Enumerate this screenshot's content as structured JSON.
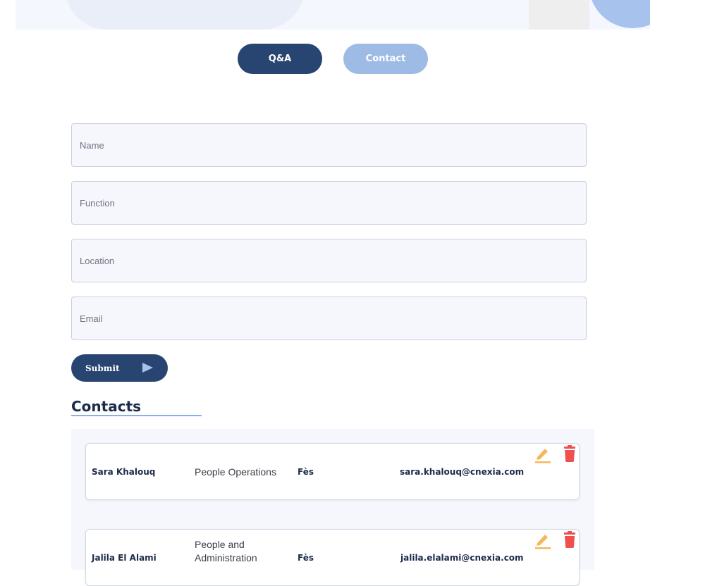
{
  "tabs": [
    {
      "label": "Q&A",
      "active": true
    },
    {
      "label": "Contact",
      "active": false
    }
  ],
  "form": {
    "fields": [
      {
        "placeholder": "Name",
        "value": ""
      },
      {
        "placeholder": "Function",
        "value": ""
      },
      {
        "placeholder": "Location",
        "value": ""
      },
      {
        "placeholder": "Email",
        "value": ""
      }
    ],
    "submit_label": "Submit"
  },
  "contacts": {
    "title": "Contacts",
    "rows": [
      {
        "name": "Sara Khalouq",
        "function": "People Operations",
        "location": "Fès",
        "email": "sara.khalouq@cnexia.com"
      },
      {
        "name": "Jalila El Alami",
        "function": "People and Administration",
        "location": "Fès",
        "email": "jalila.elalami@cnexia.com"
      }
    ]
  },
  "colors": {
    "primary": "#284470",
    "secondary": "#9ebbe6",
    "edit_icon": "#f6b75c",
    "delete_icon": "#ee4f4f"
  },
  "icons": {
    "submit": "play-icon",
    "edit": "pencil-icon",
    "delete": "trash-icon"
  }
}
